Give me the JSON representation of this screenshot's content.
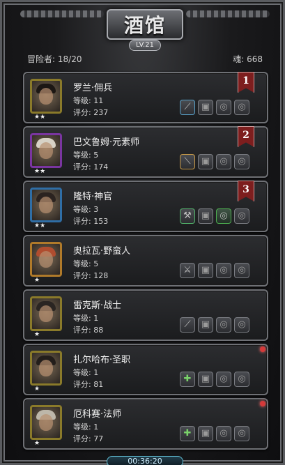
{
  "header": {
    "title": "酒馆",
    "level_badge": "LV.21"
  },
  "stats": {
    "adventurers_label": "冒险者:",
    "adventurers_value": "18/20",
    "soul_label": "魂:",
    "soul_value": "668"
  },
  "labels": {
    "level_prefix": "等级:",
    "score_prefix": "评分:"
  },
  "heroes": [
    {
      "name": "罗兰·佣兵",
      "level": "11",
      "score": "237",
      "stars": "★★",
      "rank": "1",
      "weapon": "weapon-blue"
    },
    {
      "name": "巴文鲁姆·元素师",
      "level": "5",
      "score": "174",
      "stars": "★★",
      "rank": "2",
      "weapon": "staff-orange"
    },
    {
      "name": "隆特·神官",
      "level": "3",
      "score": "153",
      "stars": "★★",
      "rank": "3",
      "weapon": "weapon-green"
    },
    {
      "name": "奥拉瓦·野蛮人",
      "level": "5",
      "score": "128",
      "stars": "★",
      "rank": "",
      "weapon": "axe"
    },
    {
      "name": "雷克斯·战士",
      "level": "1",
      "score": "88",
      "stars": "★",
      "rank": "",
      "weapon": "sword"
    },
    {
      "name": "扎尔哈布·圣职",
      "level": "1",
      "score": "81",
      "stars": "★",
      "rank": "",
      "weapon": "green-cross"
    },
    {
      "name": "厄科赛·法师",
      "level": "1",
      "score": "77",
      "stars": "★",
      "rank": "",
      "weapon": "green-cross"
    }
  ],
  "footer": {
    "timer": "00:36:20"
  },
  "colors": {
    "accent": "#63c2da",
    "rank": "#7d1e1e",
    "gold": "#8a7a2a"
  }
}
